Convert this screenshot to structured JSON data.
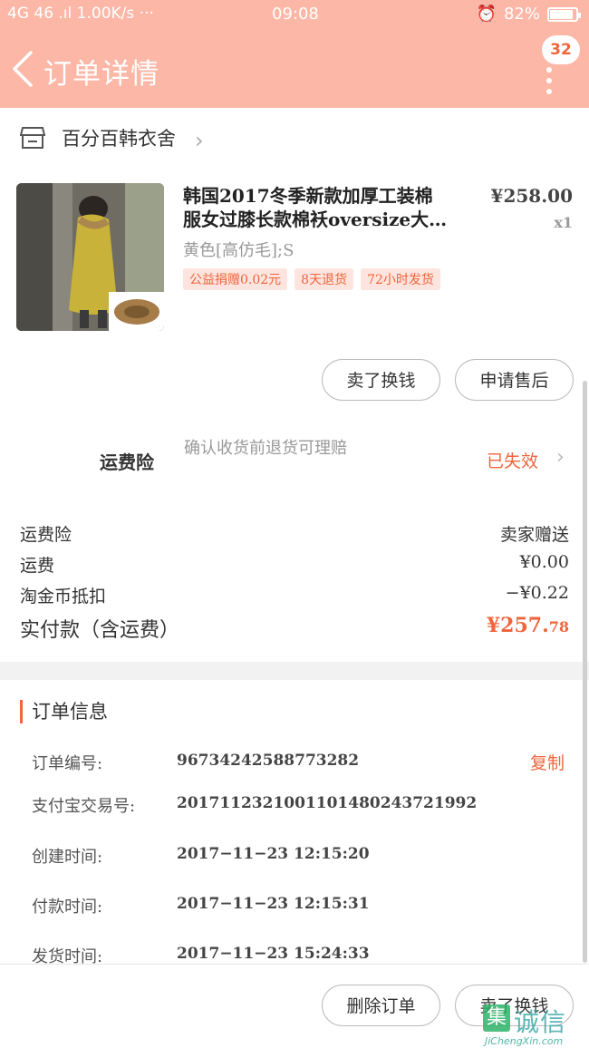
{
  "status_bar": {
    "left": "4G 46 .ıl 1.00K/s ···",
    "time": "09:08",
    "battery": "82%"
  },
  "header": {
    "title": "订单详情",
    "badge": "32"
  },
  "shop": {
    "name": "百分百韩衣舍"
  },
  "product": {
    "title_line1": "韩国2017冬季新款加厚工装棉",
    "title_line2": "服女过膝长款棉袄oversize大…",
    "price": "¥258.00",
    "qty": "x1",
    "spec": "黄色[高仿毛];S",
    "tags": [
      "公益捐赠0.02元",
      "8天退货",
      "72小时发货"
    ]
  },
  "product_actions": {
    "sell": "卖了换钱",
    "after_sale": "申请售后"
  },
  "insurance": {
    "label": "运费险",
    "desc": "确认收货前退货可理赔",
    "status": "已失效"
  },
  "costs": [
    {
      "k": "运费险",
      "v": "卖家赠送"
    },
    {
      "k": "运费",
      "v": "¥0.00"
    },
    {
      "k": "淘金币抵扣",
      "v": "−¥0.22"
    }
  ],
  "paid": {
    "label": "实付款（含运费）",
    "main": "¥257.",
    "cents": "78"
  },
  "order_info": {
    "title": "订单信息",
    "copy": "复制",
    "rows": [
      {
        "k": "订单编号:",
        "v": "96734242588773282"
      },
      {
        "k": "支付宝交易号:",
        "v": "2017112321001101480243721992"
      },
      {
        "k": "创建时间:",
        "v": "2017−11−23 12:15:20"
      },
      {
        "k": "付款时间:",
        "v": "2017−11−23 12:15:31"
      },
      {
        "k": "发货时间:",
        "v": "2017−11−23 15:24:33"
      }
    ]
  },
  "bottom_actions": {
    "delete": "删除订单",
    "sell": "卖了换钱"
  },
  "watermark": {
    "brand": "诚信",
    "mark": "集",
    "url": "JiChengXin.com"
  },
  "colors": {
    "header_bg": "#fcb7a7",
    "accent": "#f0653c"
  }
}
